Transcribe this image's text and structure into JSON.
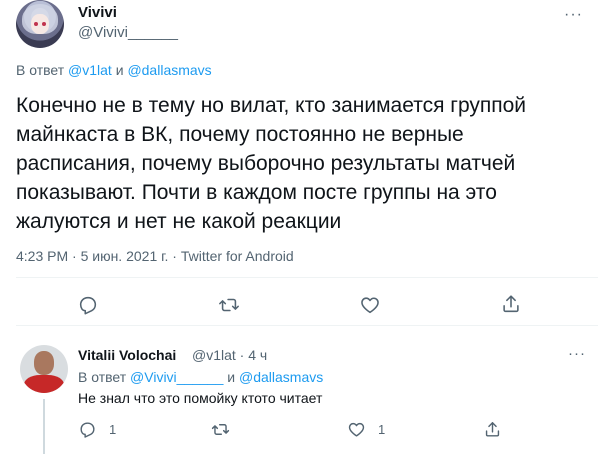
{
  "main_tweet": {
    "author_name": "Vivivi",
    "author_handle": "@Vivivi______",
    "more": "···",
    "reply_prefix": "В ответ ",
    "reply_user1": "@v1lat",
    "reply_and": " и ",
    "reply_user2": "@dallasmavs",
    "text": "Конечно не в тему но вилат, кто занимается группой майнкаста в ВК, почему постоянно не верные расписания, почему выборочно результаты матчей показывают. Почти в каждом посте группы на это жалуются и нет не какой реакции",
    "meta": "4:23 PM · 5 июн. 2021 г. · Twitter for Android"
  },
  "reply_tweet": {
    "author_name": "Vitalii Volochai",
    "author_handle": "@v1lat · 4 ч",
    "more": "···",
    "reply_prefix": "В ответ ",
    "reply_user1": "@Vivivi______",
    "reply_and": " и ",
    "reply_user2": "@dallasmavs",
    "text": "Не знал что это помойку ктото читает",
    "reply_count": "1",
    "like_count": "1"
  },
  "icons": {
    "reply": "reply-icon",
    "retweet": "retweet-icon",
    "like": "like-icon",
    "share": "share-icon",
    "more": "more-icon"
  },
  "colors": {
    "link": "#1d9bf0",
    "secondary_text": "#536471",
    "primary_text": "#0f1419"
  }
}
